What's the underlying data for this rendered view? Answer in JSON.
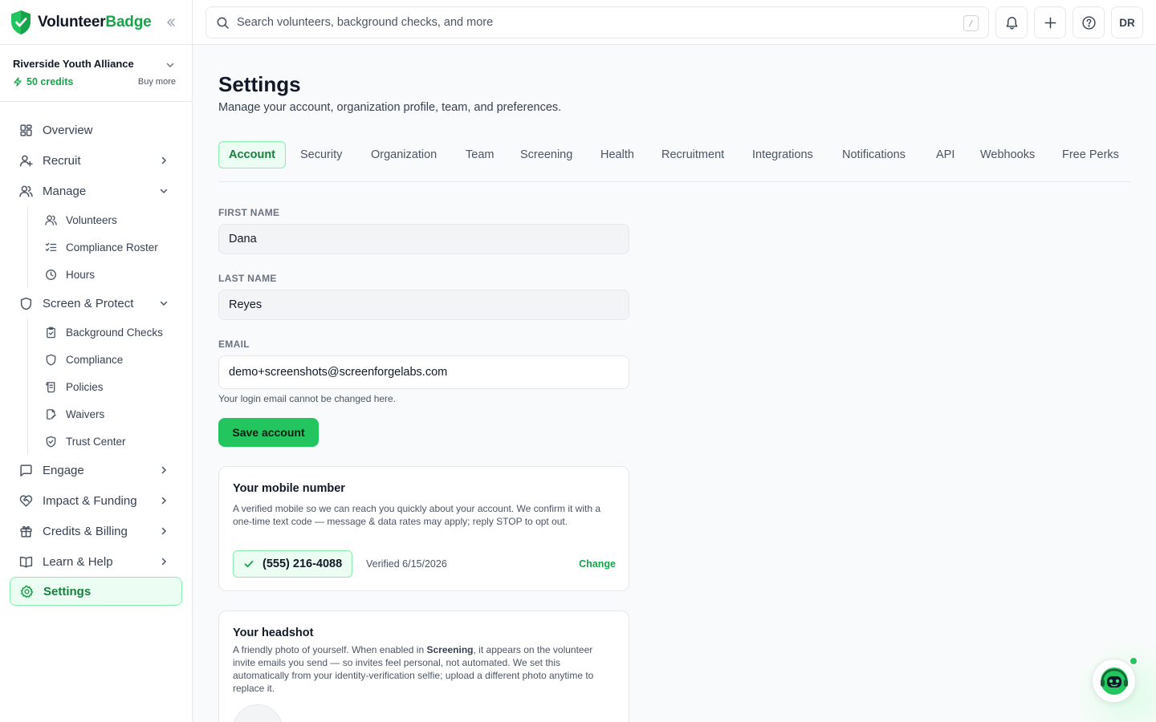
{
  "brand": {
    "name_part1": "Volunteer",
    "name_part2": "Badge"
  },
  "org": {
    "name": "Riverside Youth Alliance",
    "credits": "50 credits",
    "buy_more": "Buy more"
  },
  "nav": {
    "overview": "Overview",
    "recruit": "Recruit",
    "manage": "Manage",
    "manage_items": [
      "Volunteers",
      "Compliance Roster",
      "Hours"
    ],
    "screen": "Screen & Protect",
    "screen_items": [
      "Background Checks",
      "Compliance",
      "Policies",
      "Waivers",
      "Trust Center"
    ],
    "engage": "Engage",
    "impact": "Impact & Funding",
    "credits": "Credits & Billing",
    "learn": "Learn & Help",
    "settings": "Settings"
  },
  "search": {
    "placeholder": "Search volunteers, background checks, and more",
    "shortcut": "/"
  },
  "user": {
    "initials": "DR"
  },
  "page": {
    "title": "Settings",
    "subtitle": "Manage your account, organization profile, team, and preferences."
  },
  "tabs": [
    "Account",
    "Security",
    "Organization",
    "Team",
    "Screening",
    "Health",
    "Recruitment",
    "Integrations",
    "Notifications",
    "API",
    "Webhooks",
    "Free Perks"
  ],
  "form": {
    "first_name_label": "FIRST NAME",
    "first_name": "Dana",
    "last_name_label": "LAST NAME",
    "last_name": "Reyes",
    "email_label": "EMAIL",
    "email": "demo+screenshots@screenforgelabs.com",
    "email_hint": "Your login email cannot be changed here.",
    "save_label": "Save account"
  },
  "mobile_card": {
    "title": "Your mobile number",
    "description": "A verified mobile so we can reach you quickly about your account. We confirm it with a one-time text code — message & data rates may apply; reply STOP to opt out.",
    "phone": "(555) 216-4088",
    "verified": "Verified 6/15/2026",
    "change": "Change"
  },
  "headshot_card": {
    "title": "Your headshot",
    "desc_before": "A friendly photo of yourself. When enabled in ",
    "desc_bold": "Screening",
    "desc_after": ", it appears on the volunteer invite emails you send — so invites feel personal, not automated. We set this automatically from your identity-verification selfie; upload a different photo anytime to replace it."
  },
  "colors": {
    "brand_green": "#16a34a",
    "accent_bg": "#ecfdf3",
    "accent_border": "#86efac",
    "button": "#22c55e"
  }
}
